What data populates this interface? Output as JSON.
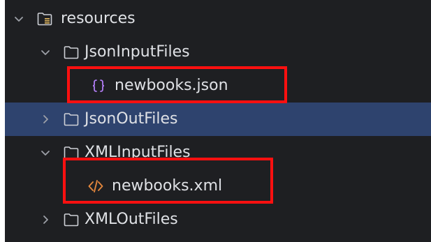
{
  "project_tree": {
    "items": [
      {
        "label": "resources",
        "icon": "resources-folder-icon",
        "state": "expanded"
      },
      {
        "label": "JsonInputFiles",
        "icon": "folder-icon",
        "state": "expanded"
      },
      {
        "label": "newbooks.json",
        "icon": "json-file-icon",
        "state": "leaf"
      },
      {
        "label": "JsonOutFiles",
        "icon": "folder-icon",
        "state": "collapsed",
        "selected": true
      },
      {
        "label": "XMLInputFiles",
        "icon": "folder-icon",
        "state": "expanded"
      },
      {
        "label": "newbooks.xml",
        "icon": "xml-file-icon",
        "state": "leaf"
      },
      {
        "label": "XMLOutFiles",
        "icon": "folder-icon",
        "state": "collapsed"
      }
    ]
  },
  "colors": {
    "background": "#1e1f22",
    "selection": "#2e436e",
    "text": "#dfe1e5",
    "highlight_border": "#ff1010",
    "json_icon": "#b07cf3",
    "xml_icon": "#e2863d"
  }
}
